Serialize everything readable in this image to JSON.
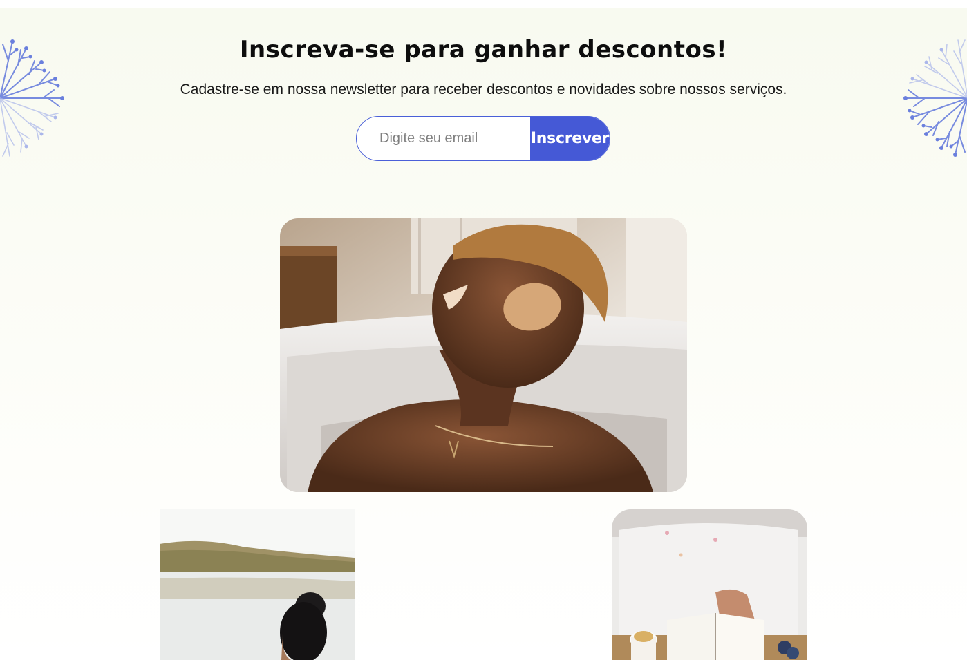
{
  "newsletter": {
    "title": "Inscreva-se para ganhar descontos!",
    "subtitle": "Cadastre-se em nossa newsletter para receber descontos e novidades sobre nossos serviços.",
    "email_placeholder": "Digite seu email",
    "submit_label": "Inscrever"
  },
  "images": [
    {
      "name": "man-relaxing-in-bathtub-eye-patches-photo"
    },
    {
      "name": "woman-by-lake-photo"
    },
    {
      "name": "bath-with-book-and-tea-photo"
    }
  ],
  "colors": {
    "accent": "#4559d6",
    "background": "#f8faf0",
    "text": "#0d0d0d"
  },
  "icons": [
    "dandelion-decoration-left-icon",
    "dandelion-decoration-right-icon"
  ]
}
